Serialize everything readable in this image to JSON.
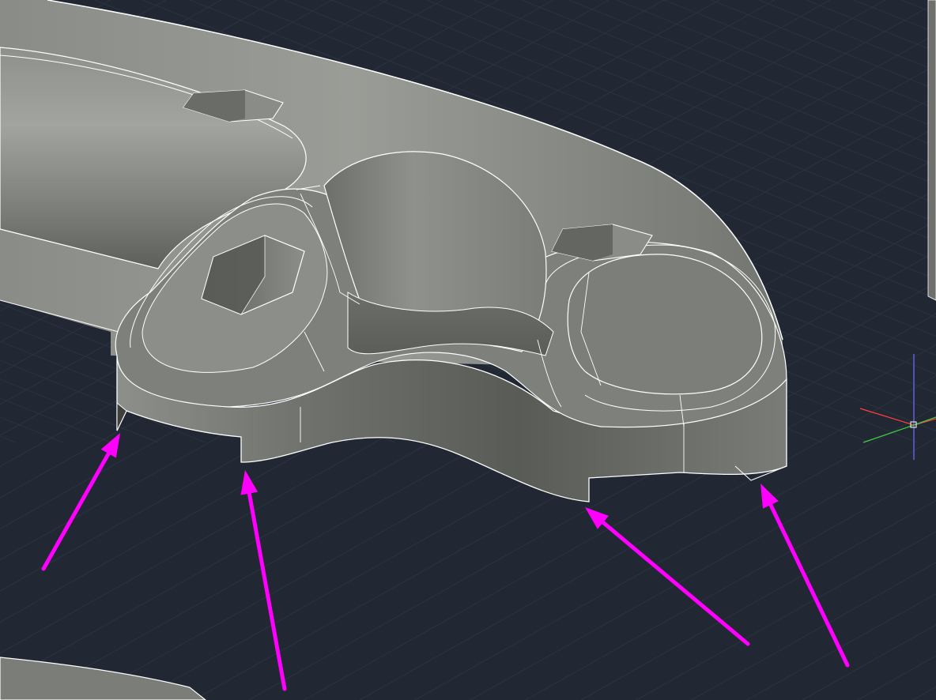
{
  "app": {
    "view_style": "shaded-with-edges",
    "view_projection": "perspective"
  },
  "colors": {
    "background": "#212833",
    "grid_minor": "#2a3340",
    "grid_major": "#323c4a",
    "part_shading_light": "#9a9c98",
    "part_shading_mid": "#7d7f7b",
    "part_shading_dark": "#545652",
    "part_edge": "#ffffff",
    "annotation_arrow": "#ff00ff",
    "ucs_x_axis": "#ff4040",
    "ucs_y_axis": "#40d040",
    "ucs_z_axis": "#7070ff"
  },
  "model": {
    "description_hidden": "",
    "hex_holes_count": 3
  },
  "annotations": {
    "arrow_count": 4,
    "arrow_icon": "magenta-arrow-icon"
  },
  "ucs_icon": {
    "icon": "ucs-crosshair-icon"
  }
}
